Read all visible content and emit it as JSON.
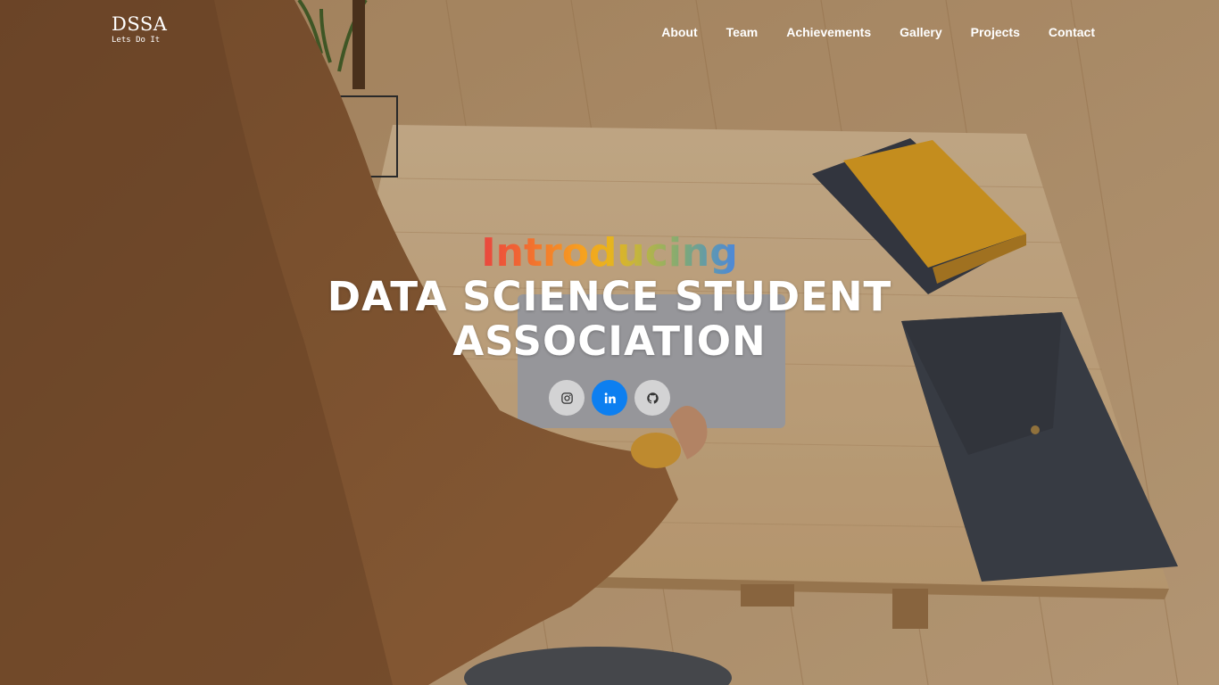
{
  "logo": {
    "title": "DSSA",
    "tagline": "Lets Do It"
  },
  "nav": {
    "items": [
      {
        "label": "About"
      },
      {
        "label": "Team"
      },
      {
        "label": "Achievements"
      },
      {
        "label": "Gallery"
      },
      {
        "label": "Projects"
      },
      {
        "label": "Contact"
      }
    ]
  },
  "hero": {
    "intro": "Introducing",
    "intro_letter_colors": [
      "#e8463f",
      "#ef5a37",
      "#f2722e",
      "#f58a27",
      "#f6a21f",
      "#e8b41d",
      "#c7b53b",
      "#9fb25a",
      "#7aa77e",
      "#5d97b4",
      "#4b86dd"
    ],
    "title_line1": "DATA SCIENCE STUDENT",
    "title_line2": "ASSOCIATION"
  },
  "socials": [
    {
      "icon": "instagram-icon",
      "active": false
    },
    {
      "icon": "linkedin-icon",
      "active": true
    },
    {
      "icon": "github-icon",
      "active": false
    }
  ],
  "colors": {
    "accent": "#0d7ff0",
    "text": "#ffffff"
  }
}
